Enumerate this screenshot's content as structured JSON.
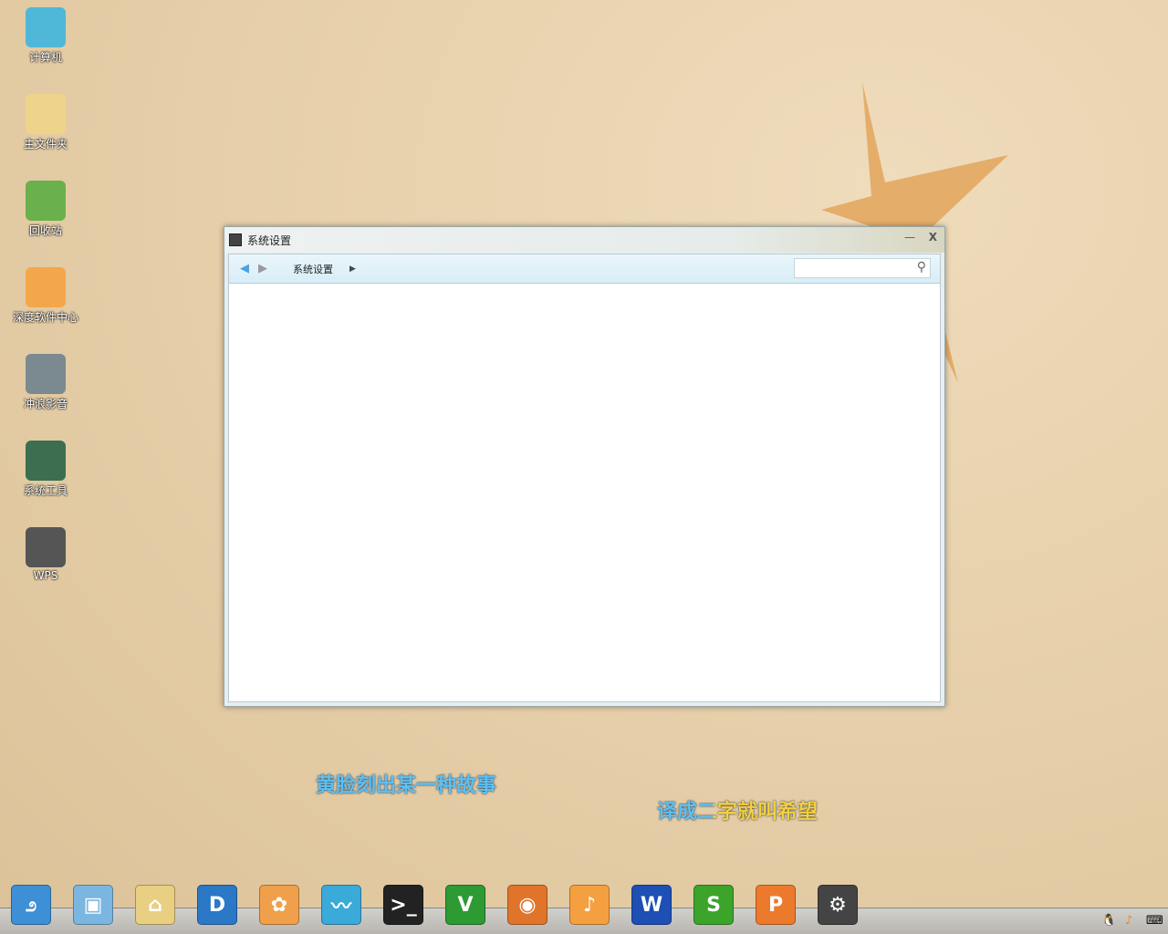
{
  "desktop": {
    "icons": [
      {
        "label": "计算机",
        "color": "#4fb8d8"
      },
      {
        "label": "主文件夹",
        "color": "#eed48a"
      },
      {
        "label": "回收站",
        "color": "#6ab04c"
      },
      {
        "label": "深度软件中心",
        "color": "#f3a64a"
      },
      {
        "label": "冲浪影音",
        "color": "#7a8a90"
      },
      {
        "label": "系统工具",
        "color": "#3c6e50"
      },
      {
        "label": "WPS",
        "color": "#555"
      }
    ]
  },
  "window": {
    "title": "系统设置",
    "breadcrumb": "系统设置",
    "search_placeholder": "",
    "minimize": "—",
    "close": "X"
  },
  "lyrics": {
    "line1": "黄脸刻出某一种故事",
    "line2": "译成二字就叫希望"
  },
  "dock": {
    "items": [
      {
        "name": "deepin-launcher",
        "glyph": "೨",
        "color": "#3d8fd6"
      },
      {
        "name": "image-viewer",
        "glyph": "▣",
        "color": "#7bb6e0"
      },
      {
        "name": "home-folder",
        "glyph": "⌂",
        "color": "#e8cf82"
      },
      {
        "name": "deepin-player",
        "glyph": "D",
        "color": "#2a78c6"
      },
      {
        "name": "software-center",
        "glyph": "✿",
        "color": "#f0a04a"
      },
      {
        "name": "system-monitor",
        "glyph": "〰",
        "color": "#3aaad8"
      },
      {
        "name": "terminal",
        "glyph": ">_",
        "color": "#222"
      },
      {
        "name": "vim",
        "glyph": "V",
        "color": "#2d9a34"
      },
      {
        "name": "firefox",
        "glyph": "◉",
        "color": "#e0742a"
      },
      {
        "name": "deepin-music",
        "glyph": "♪",
        "color": "#f5a040"
      },
      {
        "name": "wps-writer",
        "glyph": "W",
        "color": "#1d4fb4"
      },
      {
        "name": "wps-spreadsheet",
        "glyph": "S",
        "color": "#3ca42a"
      },
      {
        "name": "wps-presentation",
        "glyph": "P",
        "color": "#ec7a2c"
      },
      {
        "name": "system-settings",
        "glyph": "⚙",
        "color": "#444"
      }
    ]
  },
  "tray": {
    "qq": "🐧",
    "music": "♪",
    "keyboard": "⌨"
  }
}
